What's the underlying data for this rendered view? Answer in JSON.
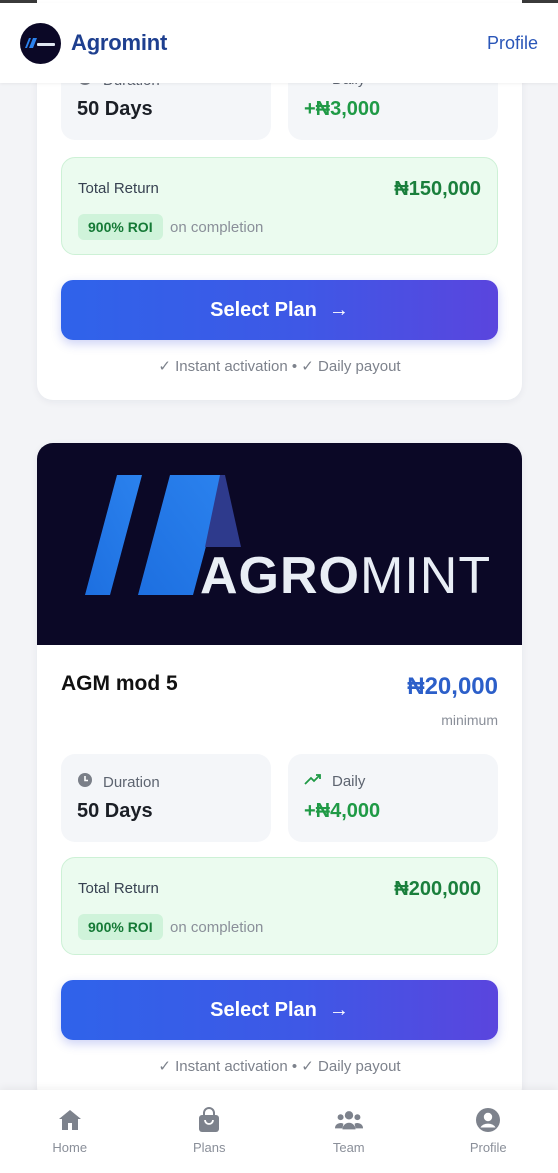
{
  "header": {
    "brand_name": "Agromint",
    "profile_link": "Profile"
  },
  "prev_card": {
    "duration_label": "Duration",
    "duration_value": "50 Days",
    "daily_label": "Daily",
    "daily_value": "+₦3,000",
    "total_return_label": "Total Return",
    "total_return_value": "₦150,000",
    "roi_badge": "900% ROI",
    "roi_note": "on completion",
    "select_button": "Select Plan",
    "footnote": "✓ Instant activation • ✓ Daily payout"
  },
  "plan_card": {
    "banner_logo_text_bold": "AGRO",
    "banner_logo_text_light": "MINT",
    "title": "AGM mod 5",
    "price": "₦20,000",
    "price_note": "minimum",
    "duration_label": "Duration",
    "duration_value": "50 Days",
    "daily_label": "Daily",
    "daily_value": "+₦4,000",
    "total_return_label": "Total Return",
    "total_return_value": "₦200,000",
    "roi_badge": "900% ROI",
    "roi_note": "on completion",
    "select_button": "Select Plan",
    "footnote": "✓ Instant activation • ✓ Daily payout"
  },
  "bottom_nav": {
    "items": [
      {
        "label": "Home",
        "icon": "home-icon"
      },
      {
        "label": "Plans",
        "icon": "shopping-bag-icon"
      },
      {
        "label": "Team",
        "icon": "team-icon"
      },
      {
        "label": "Profile",
        "icon": "user-icon"
      }
    ]
  },
  "colors": {
    "brand_dark": "#0b0826",
    "brand_blue": "#1e3f8f",
    "accent_blue": "#2c5fc9",
    "green": "#1f9a46"
  }
}
